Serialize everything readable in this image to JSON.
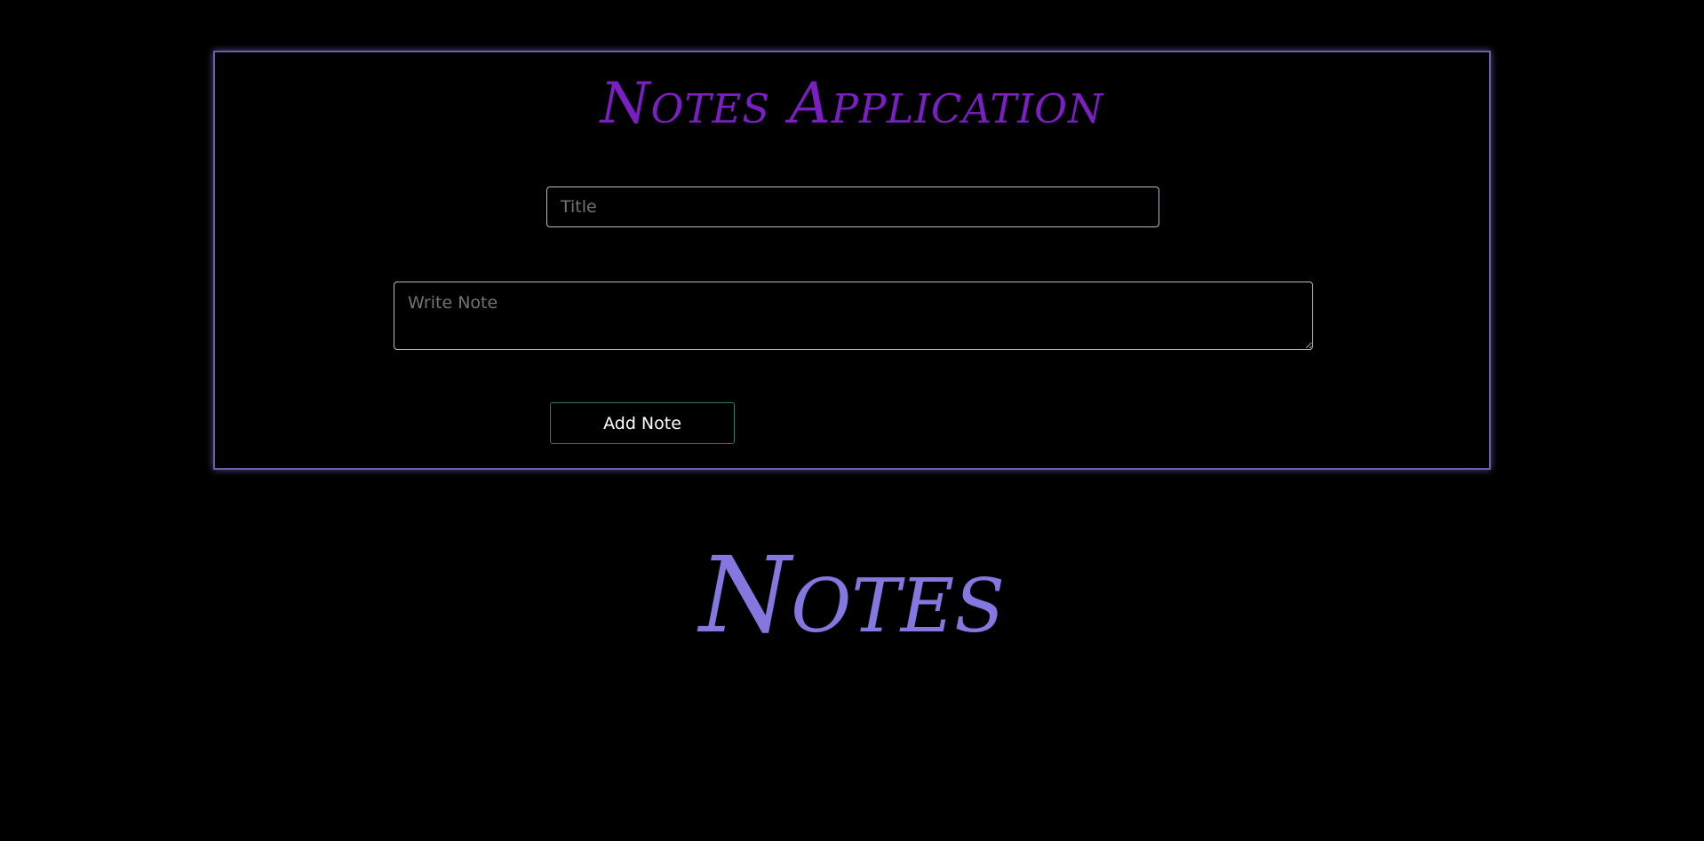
{
  "app": {
    "title": "Notes Application"
  },
  "form": {
    "title_placeholder": "Title",
    "title_value": "",
    "note_placeholder": "Write Note",
    "note_value": "",
    "add_button_label": "Add Note"
  },
  "notes_section": {
    "heading": "Notes"
  },
  "colors": {
    "background": "#000000",
    "app_title": "#7b1fc4",
    "notes_heading": "#8478e0",
    "card_border": "#6a5fa8",
    "button_border": "#2f7a5a"
  }
}
